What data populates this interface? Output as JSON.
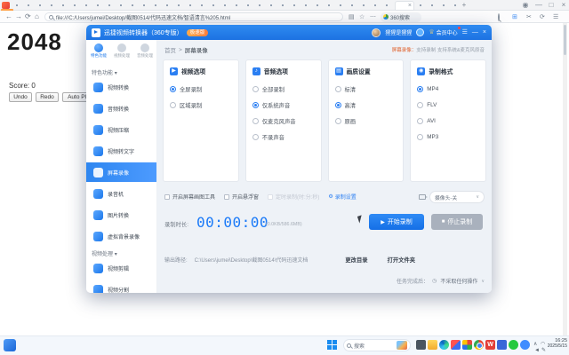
{
  "browser": {
    "url": "file:///C:/Users/jumei/Desktop/截图0514/代码迅速文档/智语清言%205.html",
    "search_label": "360搜索",
    "new_tab": "+"
  },
  "game": {
    "title": "2048",
    "score": "Score: 0",
    "undo": "Undo",
    "redo": "Redo",
    "autoplay": "Auto Play"
  },
  "app": {
    "title": "迅捷视频转换器（360专版）",
    "badge": "极速版",
    "username": "猩猩是猩猩",
    "vip_label": "会员中心",
    "sidebar": {
      "tabs": [
        {
          "label": "特色功能"
        },
        {
          "label": "视频处理"
        },
        {
          "label": "音频处理"
        }
      ],
      "sections": [
        {
          "label": "特色功能",
          "items": [
            {
              "label": "视频转换"
            },
            {
              "label": "音频转换"
            },
            {
              "label": "视频压缩"
            },
            {
              "label": "视频转文字"
            },
            {
              "label": "屏幕录像"
            },
            {
              "label": "录音机"
            },
            {
              "label": "图片转换"
            },
            {
              "label": "虚拟背景录像"
            }
          ]
        },
        {
          "label": "视频处理",
          "items": [
            {
              "label": "视频剪辑"
            },
            {
              "label": "视频分割"
            }
          ]
        }
      ]
    },
    "breadcrumb": {
      "home": "首页",
      "sep": ">",
      "current": "屏幕录像"
    },
    "tip_em": "屏幕录像：",
    "tip_text": "支持录制 支持系统&麦克风原音",
    "cards": [
      {
        "title": "视频选项",
        "options": [
          {
            "label": "全屏录制",
            "selected": true
          },
          {
            "label": "区域录制",
            "selected": false
          }
        ]
      },
      {
        "title": "音频选项",
        "options": [
          {
            "label": "全部录制",
            "selected": false
          },
          {
            "label": "仅系统声音",
            "selected": true
          },
          {
            "label": "仅麦克风声音",
            "selected": false
          },
          {
            "label": "不录声音",
            "selected": false
          }
        ]
      },
      {
        "title": "画质设置",
        "options": [
          {
            "label": "标清",
            "selected": false
          },
          {
            "label": "高清",
            "selected": true
          },
          {
            "label": "原画",
            "selected": false
          }
        ]
      },
      {
        "title": "录制格式",
        "options": [
          {
            "label": "MP4",
            "selected": true
          },
          {
            "label": "FLV",
            "selected": false
          },
          {
            "label": "AVI",
            "selected": false
          },
          {
            "label": "MP3",
            "selected": false
          }
        ]
      }
    ],
    "toggles": [
      {
        "label": "开启屏幕画图工具"
      },
      {
        "label": "开启悬浮窗"
      },
      {
        "label": "定时录制(时:分:秒)"
      }
    ],
    "record_settings": "录制设置",
    "camera_dropdown": "摄像头-关",
    "duration_label": "录制时长:",
    "duration_value": "00:00:00",
    "size_info": "(0.0KB/586.6MB)",
    "start_button": "开始录制",
    "stop_button": "停止录制",
    "output_label": "输出路径:",
    "output_path": "C:\\Users\\jumei\\Desktop\\截图0514\\代码迅速文档",
    "change_dir": "更改目录",
    "open_folder": "打开文件夹",
    "after_label": "任务完成后：",
    "after_value": "不采取任何操作"
  },
  "taskbar": {
    "search": "搜索",
    "time": "16:25",
    "date": "2025/5/15"
  },
  "icons": {
    "play": "▶",
    "stop": "■",
    "gear": "⚙",
    "clock": "◷",
    "caret": "▾",
    "chevron": "∨",
    "crown": "♕",
    "back": "←",
    "fwd": "→",
    "reload": "⟳",
    "home": "⌂",
    "star": "☆",
    "more": "⋯",
    "menu": "☰",
    "min": "—",
    "max": "□",
    "close": "×",
    "plus": "+",
    "scissors": "✂",
    "grid": "⊞",
    "doc": "▤",
    "up": "∧",
    "dot": "●",
    "wifi": "◠",
    "vol": "◄",
    "pen": "✎",
    "note": "♪",
    "screen": "▤",
    "disc": "◉"
  }
}
